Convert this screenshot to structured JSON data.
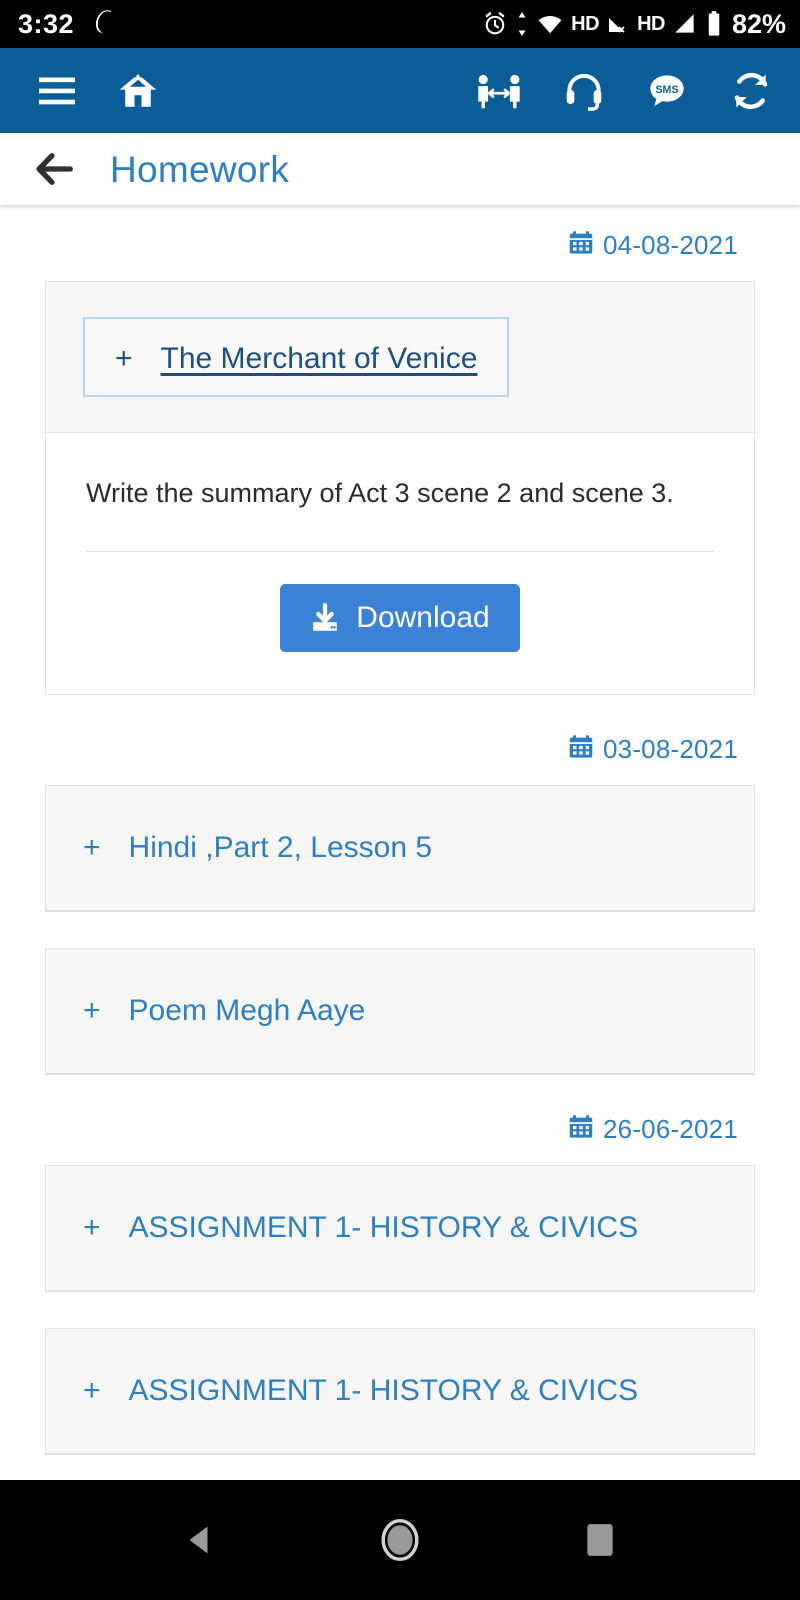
{
  "status_bar": {
    "time": "3:32",
    "battery_percent": "82%",
    "hd_label_1": "HD",
    "hd_label_2": "HD",
    "icons": [
      "opera-icon",
      "alarm-clock-icon",
      "data-transfer-icon",
      "wifi-icon",
      "signal-no-sim-icon",
      "signal-icon",
      "battery-icon"
    ]
  },
  "app_bar": {
    "background": "#0a5d96",
    "left_icons": [
      "hamburger-menu-icon",
      "home-icon"
    ],
    "right_icons": [
      "social-distancing-icon",
      "headset-support-icon",
      "sms-icon",
      "sync-refresh-icon"
    ],
    "sms_label": "SMS"
  },
  "title_bar": {
    "back_icon": "back-arrow-icon",
    "title": "Homework",
    "title_color": "#2f7fc0"
  },
  "groups": [
    {
      "date": "04-08-2021",
      "items": [
        {
          "title": "The Merchant of Venice",
          "expanded": true,
          "focused": true,
          "plus": "+",
          "body": "Write the summary of Act 3 scene 2 and scene 3.",
          "download_label": "Download"
        }
      ]
    },
    {
      "date": "03-08-2021",
      "items": [
        {
          "title": "Hindi ,Part 2, Lesson 5",
          "expanded": false,
          "focused": false,
          "plus": "+"
        },
        {
          "title": "Poem Megh Aaye",
          "expanded": false,
          "focused": false,
          "plus": "+"
        }
      ]
    },
    {
      "date": "26-06-2021",
      "items": [
        {
          "title": "ASSIGNMENT 1- HISTORY & CIVICS",
          "expanded": false,
          "focused": false,
          "plus": "+"
        },
        {
          "title": "ASSIGNMENT 1- HISTORY & CIVICS",
          "expanded": false,
          "focused": false,
          "plus": "+"
        }
      ]
    }
  ],
  "nav_bar": {
    "items": [
      "back-triangle-icon",
      "home-circle-icon",
      "recents-square-icon"
    ]
  }
}
